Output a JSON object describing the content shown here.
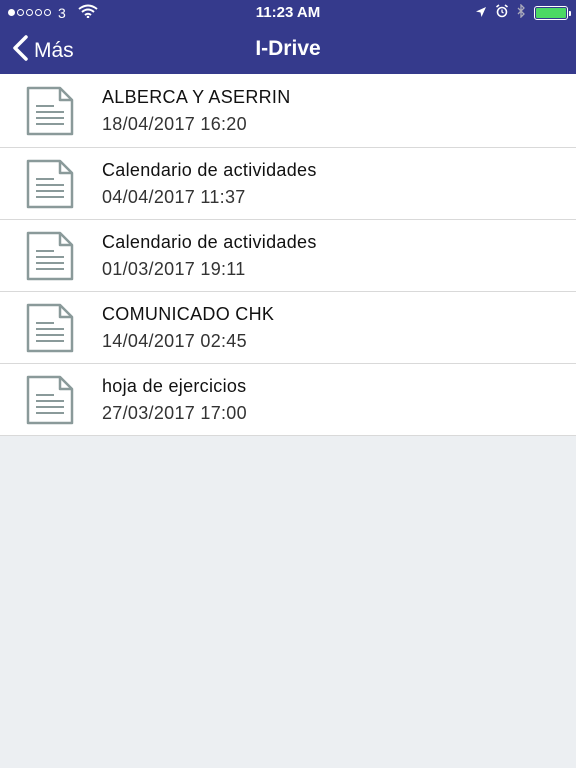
{
  "status_bar": {
    "carrier": "3",
    "time": "11:23 AM",
    "signal_filled": 1,
    "signal_total": 5,
    "battery_level": 1.0,
    "icons": [
      "location-arrow-icon",
      "alarm-icon",
      "bluetooth-icon",
      "battery-icon"
    ]
  },
  "navbar": {
    "back_label": "Más",
    "title": "I-Drive"
  },
  "files": [
    {
      "name": "ALBERCA Y ASERRIN",
      "date": "18/04/2017 16:20"
    },
    {
      "name": "Calendario de actividades",
      "date": "04/04/2017 11:37"
    },
    {
      "name": "Calendario de actividades",
      "date": "01/03/2017 19:11"
    },
    {
      "name": "COMUNICADO CHK",
      "date": "14/04/2017 02:45"
    },
    {
      "name": "hoja de ejercicios",
      "date": "27/03/2017 17:00"
    }
  ],
  "colors": {
    "header": "#353a8c",
    "background": "#eceff2",
    "icon_stroke": "#8a9a9a",
    "battery": "#4cd964"
  }
}
